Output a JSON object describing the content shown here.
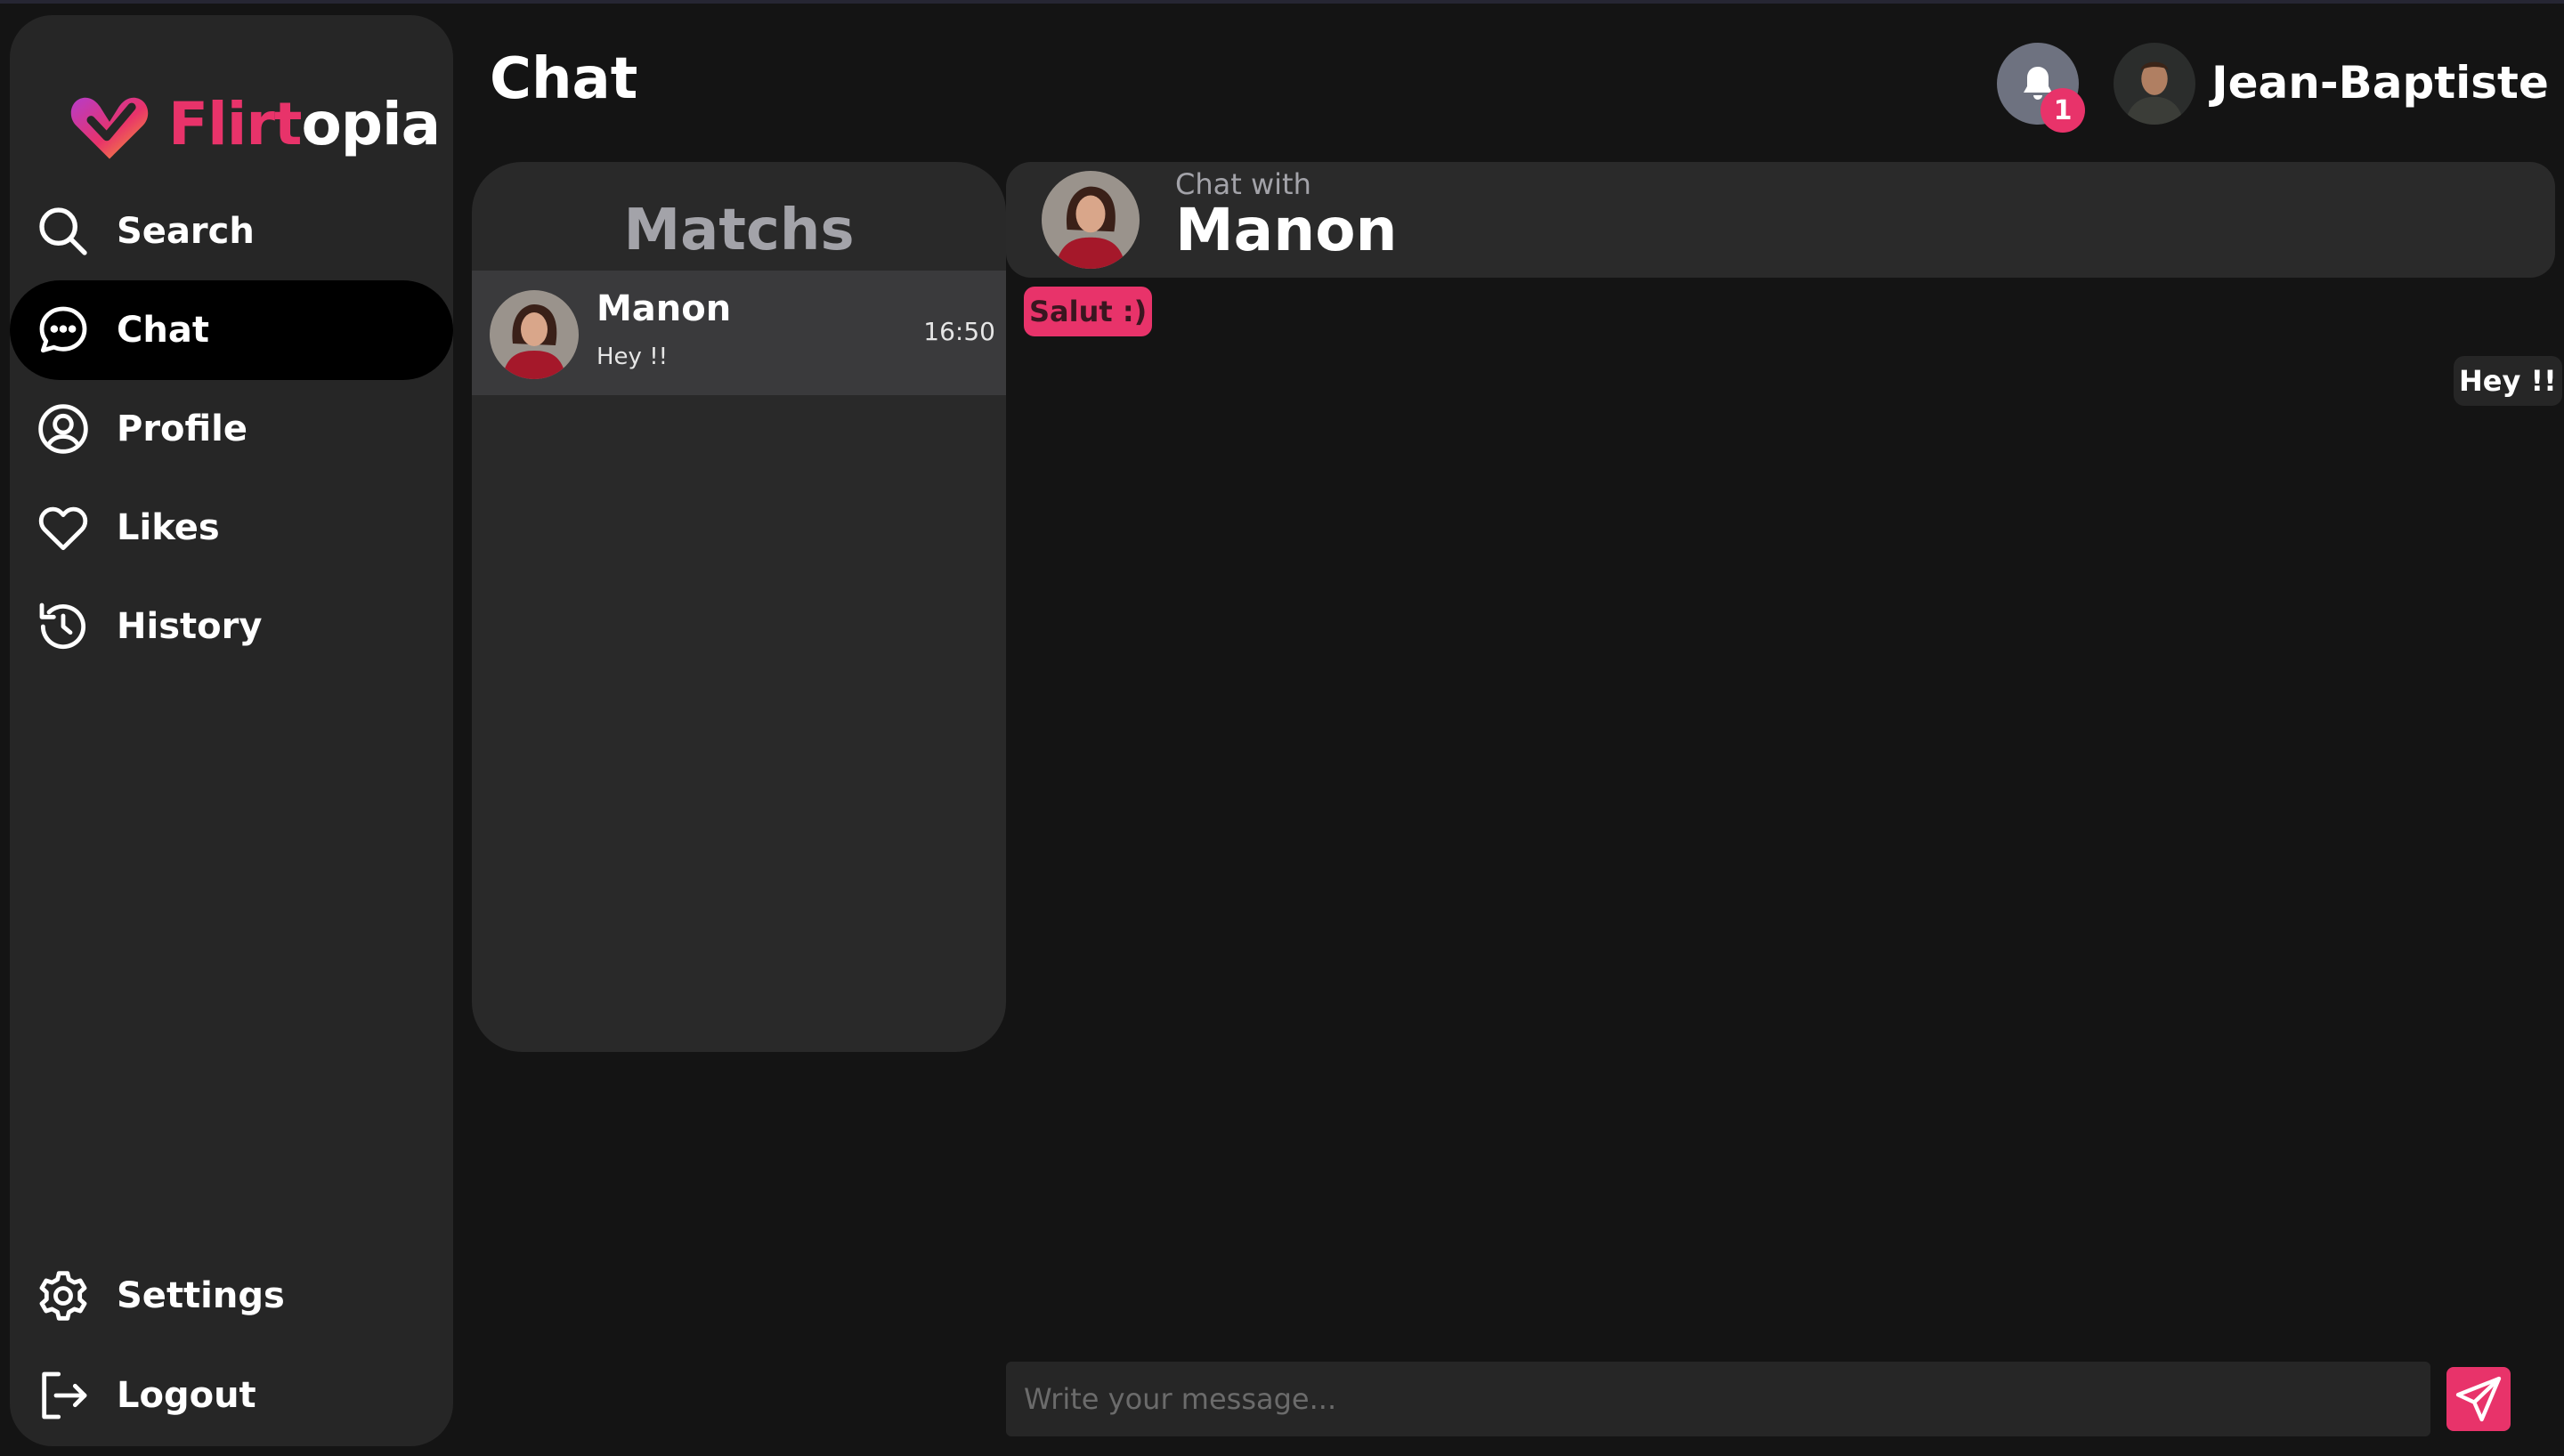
{
  "app": {
    "name_part1": "Flirt",
    "name_part2": "opia"
  },
  "header": {
    "title": "Chat",
    "notification_count": "1",
    "user_name": "Jean-Baptiste"
  },
  "sidebar": {
    "items": [
      {
        "label": "Search",
        "icon": "search-icon"
      },
      {
        "label": "Chat",
        "icon": "chat-icon",
        "active": true
      },
      {
        "label": "Profile",
        "icon": "user-circle-icon"
      },
      {
        "label": "Likes",
        "icon": "heart-icon"
      },
      {
        "label": "History",
        "icon": "history-icon"
      }
    ],
    "bottom_items": [
      {
        "label": "Settings",
        "icon": "gear-icon"
      },
      {
        "label": "Logout",
        "icon": "logout-icon"
      }
    ]
  },
  "matches": {
    "title": "Matchs",
    "items": [
      {
        "name": "Manon",
        "time": "16:50",
        "last_message": "Hey !!"
      }
    ]
  },
  "chat": {
    "with_label": "Chat with",
    "name": "Manon",
    "messages": [
      {
        "from": "them",
        "text": "Salut :)"
      },
      {
        "from": "me",
        "text": "Hey !!"
      }
    ]
  },
  "composer": {
    "placeholder": "Write your message..."
  },
  "colors": {
    "accent": "#e8336a",
    "background": "#141414",
    "panel": "#262626",
    "active_nav": "#000000"
  }
}
